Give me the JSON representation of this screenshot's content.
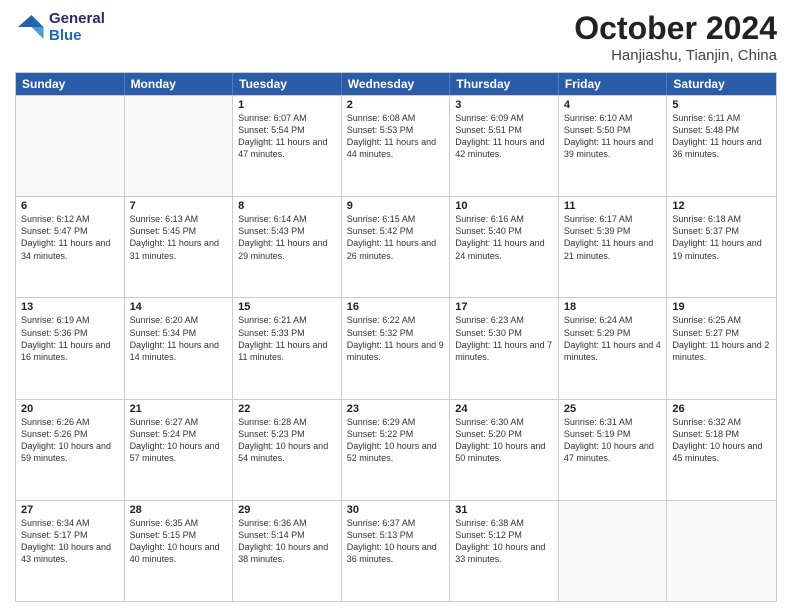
{
  "header": {
    "logo_line1": "General",
    "logo_line2": "Blue",
    "month": "October 2024",
    "location": "Hanjiashu, Tianjin, China"
  },
  "days_of_week": [
    "Sunday",
    "Monday",
    "Tuesday",
    "Wednesday",
    "Thursday",
    "Friday",
    "Saturday"
  ],
  "rows": [
    [
      {
        "day": "",
        "info": ""
      },
      {
        "day": "",
        "info": ""
      },
      {
        "day": "1",
        "info": "Sunrise: 6:07 AM\nSunset: 5:54 PM\nDaylight: 11 hours and 47 minutes."
      },
      {
        "day": "2",
        "info": "Sunrise: 6:08 AM\nSunset: 5:53 PM\nDaylight: 11 hours and 44 minutes."
      },
      {
        "day": "3",
        "info": "Sunrise: 6:09 AM\nSunset: 5:51 PM\nDaylight: 11 hours and 42 minutes."
      },
      {
        "day": "4",
        "info": "Sunrise: 6:10 AM\nSunset: 5:50 PM\nDaylight: 11 hours and 39 minutes."
      },
      {
        "day": "5",
        "info": "Sunrise: 6:11 AM\nSunset: 5:48 PM\nDaylight: 11 hours and 36 minutes."
      }
    ],
    [
      {
        "day": "6",
        "info": "Sunrise: 6:12 AM\nSunset: 5:47 PM\nDaylight: 11 hours and 34 minutes."
      },
      {
        "day": "7",
        "info": "Sunrise: 6:13 AM\nSunset: 5:45 PM\nDaylight: 11 hours and 31 minutes."
      },
      {
        "day": "8",
        "info": "Sunrise: 6:14 AM\nSunset: 5:43 PM\nDaylight: 11 hours and 29 minutes."
      },
      {
        "day": "9",
        "info": "Sunrise: 6:15 AM\nSunset: 5:42 PM\nDaylight: 11 hours and 26 minutes."
      },
      {
        "day": "10",
        "info": "Sunrise: 6:16 AM\nSunset: 5:40 PM\nDaylight: 11 hours and 24 minutes."
      },
      {
        "day": "11",
        "info": "Sunrise: 6:17 AM\nSunset: 5:39 PM\nDaylight: 11 hours and 21 minutes."
      },
      {
        "day": "12",
        "info": "Sunrise: 6:18 AM\nSunset: 5:37 PM\nDaylight: 11 hours and 19 minutes."
      }
    ],
    [
      {
        "day": "13",
        "info": "Sunrise: 6:19 AM\nSunset: 5:36 PM\nDaylight: 11 hours and 16 minutes."
      },
      {
        "day": "14",
        "info": "Sunrise: 6:20 AM\nSunset: 5:34 PM\nDaylight: 11 hours and 14 minutes."
      },
      {
        "day": "15",
        "info": "Sunrise: 6:21 AM\nSunset: 5:33 PM\nDaylight: 11 hours and 11 minutes."
      },
      {
        "day": "16",
        "info": "Sunrise: 6:22 AM\nSunset: 5:32 PM\nDaylight: 11 hours and 9 minutes."
      },
      {
        "day": "17",
        "info": "Sunrise: 6:23 AM\nSunset: 5:30 PM\nDaylight: 11 hours and 7 minutes."
      },
      {
        "day": "18",
        "info": "Sunrise: 6:24 AM\nSunset: 5:29 PM\nDaylight: 11 hours and 4 minutes."
      },
      {
        "day": "19",
        "info": "Sunrise: 6:25 AM\nSunset: 5:27 PM\nDaylight: 11 hours and 2 minutes."
      }
    ],
    [
      {
        "day": "20",
        "info": "Sunrise: 6:26 AM\nSunset: 5:26 PM\nDaylight: 10 hours and 59 minutes."
      },
      {
        "day": "21",
        "info": "Sunrise: 6:27 AM\nSunset: 5:24 PM\nDaylight: 10 hours and 57 minutes."
      },
      {
        "day": "22",
        "info": "Sunrise: 6:28 AM\nSunset: 5:23 PM\nDaylight: 10 hours and 54 minutes."
      },
      {
        "day": "23",
        "info": "Sunrise: 6:29 AM\nSunset: 5:22 PM\nDaylight: 10 hours and 52 minutes."
      },
      {
        "day": "24",
        "info": "Sunrise: 6:30 AM\nSunset: 5:20 PM\nDaylight: 10 hours and 50 minutes."
      },
      {
        "day": "25",
        "info": "Sunrise: 6:31 AM\nSunset: 5:19 PM\nDaylight: 10 hours and 47 minutes."
      },
      {
        "day": "26",
        "info": "Sunrise: 6:32 AM\nSunset: 5:18 PM\nDaylight: 10 hours and 45 minutes."
      }
    ],
    [
      {
        "day": "27",
        "info": "Sunrise: 6:34 AM\nSunset: 5:17 PM\nDaylight: 10 hours and 43 minutes."
      },
      {
        "day": "28",
        "info": "Sunrise: 6:35 AM\nSunset: 5:15 PM\nDaylight: 10 hours and 40 minutes."
      },
      {
        "day": "29",
        "info": "Sunrise: 6:36 AM\nSunset: 5:14 PM\nDaylight: 10 hours and 38 minutes."
      },
      {
        "day": "30",
        "info": "Sunrise: 6:37 AM\nSunset: 5:13 PM\nDaylight: 10 hours and 36 minutes."
      },
      {
        "day": "31",
        "info": "Sunrise: 6:38 AM\nSunset: 5:12 PM\nDaylight: 10 hours and 33 minutes."
      },
      {
        "day": "",
        "info": ""
      },
      {
        "day": "",
        "info": ""
      }
    ]
  ]
}
